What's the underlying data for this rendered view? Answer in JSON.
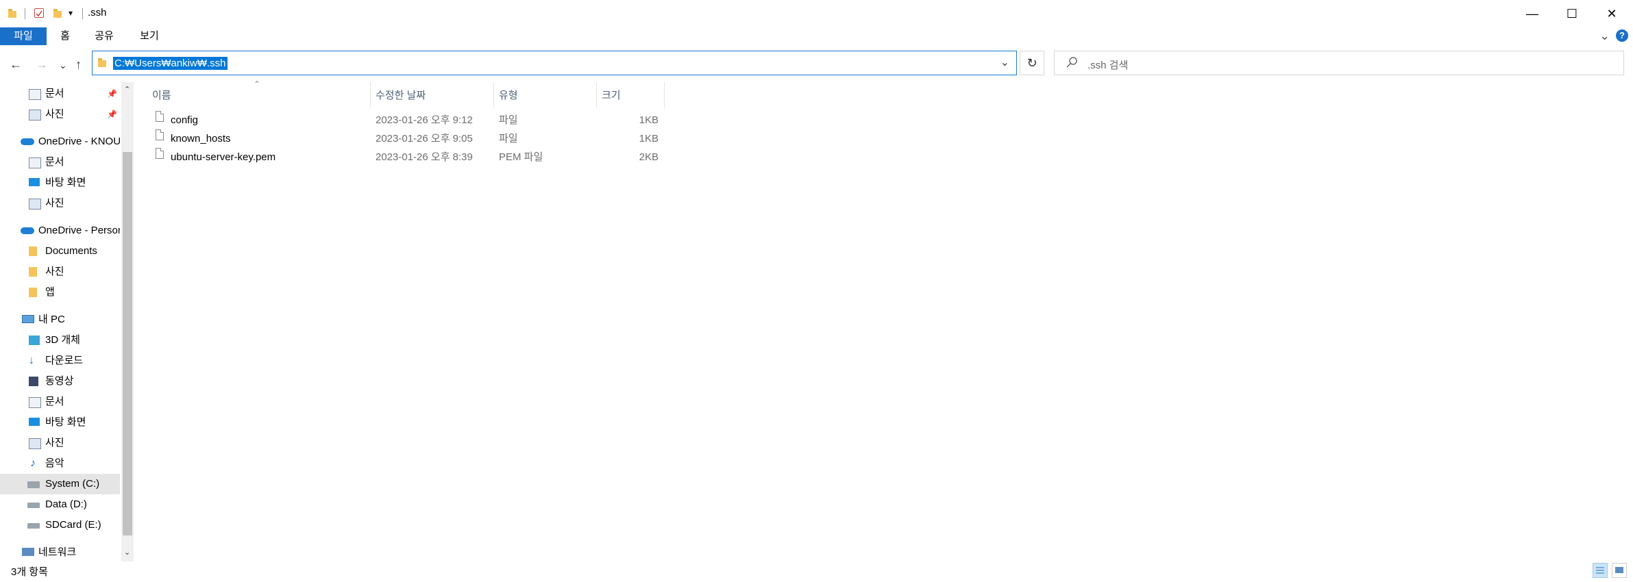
{
  "window": {
    "title": ".ssh",
    "minimize": "—",
    "maximize": "☐",
    "close": "✕"
  },
  "ribbon": {
    "tabs": [
      "파일",
      "홈",
      "공유",
      "보기"
    ],
    "collapse": "⌄",
    "help": "?"
  },
  "address": {
    "path": "C:₩Users₩ankiw₩.ssh",
    "dropdown": "⌄",
    "refresh": "↻"
  },
  "search": {
    "placeholder": ".ssh 검색"
  },
  "nav": {
    "items": [
      {
        "label": "문서",
        "icon": "document-icon",
        "pinned": true
      },
      {
        "label": "사진",
        "icon": "pictures-icon",
        "pinned": true
      },
      {
        "label": "OneDrive - KNOU",
        "icon": "onedrive-icon"
      },
      {
        "label": "문서",
        "icon": "document-icon"
      },
      {
        "label": "바탕 화면",
        "icon": "desktop-icon"
      },
      {
        "label": "사진",
        "icon": "pictures-icon"
      },
      {
        "label": "OneDrive - Personal",
        "icon": "onedrive-icon"
      },
      {
        "label": "Documents",
        "icon": "folder-icon"
      },
      {
        "label": "사진",
        "icon": "folder-icon"
      },
      {
        "label": "앱",
        "icon": "folder-icon"
      },
      {
        "label": "내 PC",
        "icon": "pc-icon"
      },
      {
        "label": "3D 개체",
        "icon": "3d-objects-icon"
      },
      {
        "label": "다운로드",
        "icon": "download-icon"
      },
      {
        "label": "동영상",
        "icon": "video-icon"
      },
      {
        "label": "문서",
        "icon": "document-icon"
      },
      {
        "label": "바탕 화면",
        "icon": "desktop-icon"
      },
      {
        "label": "사진",
        "icon": "pictures-icon"
      },
      {
        "label": "음악",
        "icon": "music-icon"
      },
      {
        "label": "System (C:)",
        "icon": "drive-icon",
        "selected": true
      },
      {
        "label": "Data (D:)",
        "icon": "drive-icon"
      },
      {
        "label": "SDCard (E:)",
        "icon": "drive-icon"
      },
      {
        "label": "네트워크",
        "icon": "network-icon"
      }
    ]
  },
  "columns": {
    "name": "이름",
    "modified": "수정한 날짜",
    "type": "유형",
    "size": "크기"
  },
  "files": [
    {
      "name": "config",
      "modified": "2023-01-26 오후 9:12",
      "type": "파일",
      "size": "1KB"
    },
    {
      "name": "known_hosts",
      "modified": "2023-01-26 오후 9:05",
      "type": "파일",
      "size": "1KB"
    },
    {
      "name": "ubuntu-server-key.pem",
      "modified": "2023-01-26 오후 8:39",
      "type": "PEM 파일",
      "size": "2KB"
    }
  ],
  "status": {
    "count": "3개 항목"
  },
  "colors": {
    "accent": "#0078d7",
    "ribbon_file": "#1a6fc9",
    "folder": "#f4c45a"
  }
}
